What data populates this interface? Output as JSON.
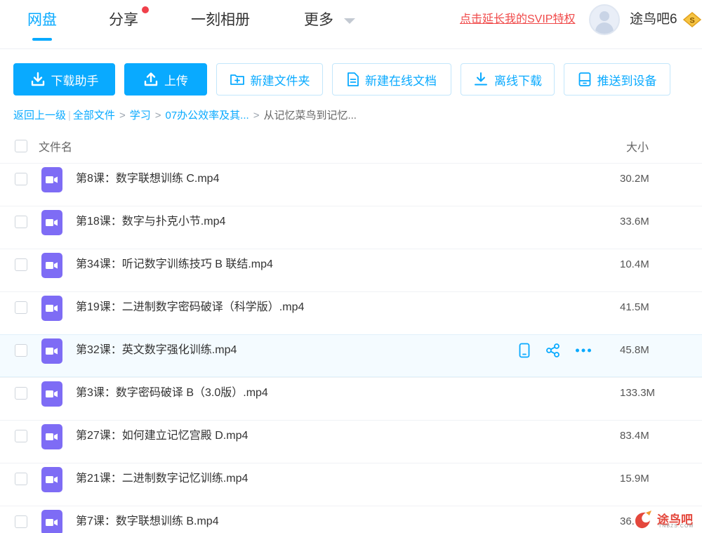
{
  "nav": {
    "items": [
      {
        "label": "网盘",
        "active": true
      },
      {
        "label": "分享",
        "active": false
      },
      {
        "label": "一刻相册",
        "active": false
      },
      {
        "label": "更多",
        "active": false
      }
    ],
    "svip_link": "点击延长我的SVIP特权",
    "username": "途鸟吧6",
    "vip_badge": "S"
  },
  "toolbar": {
    "download_helper": "下载助手",
    "upload": "上传",
    "new_folder": "新建文件夹",
    "new_online_doc": "新建在线文档",
    "offline_download": "离线下载",
    "push_to_device": "推送到设备"
  },
  "breadcrumb": {
    "back": "返回上一级",
    "all_files": "全部文件",
    "level1": "学习",
    "level2": "07办公效率及其...",
    "current": "从记忆菜鸟到记忆..."
  },
  "table": {
    "col_name": "文件名",
    "col_size": "大小",
    "rows": [
      {
        "name": "第8课：数字联想训练 C.mp4",
        "size": "30.2M"
      },
      {
        "name": "第18课：数字与扑克小节.mp4",
        "size": "33.6M"
      },
      {
        "name": "第34课：听记数字训练技巧 B 联结.mp4",
        "size": "10.4M"
      },
      {
        "name": "第19课：二进制数字密码破译（科学版）.mp4",
        "size": "41.5M"
      },
      {
        "name": "第32课：英文数字强化训练.mp4",
        "size": "45.8M"
      },
      {
        "name": "第3课：数字密码破译 B（3.0版）.mp4",
        "size": "133.3M"
      },
      {
        "name": "第27课：如何建立记忆宫殿 D.mp4",
        "size": "83.4M"
      },
      {
        "name": "第21课：二进制数字记忆训练.mp4",
        "size": "15.9M"
      },
      {
        "name": "第7课：数字联想训练 B.mp4",
        "size": "36."
      }
    ]
  },
  "watermark": {
    "text": "途鸟吧",
    "sub": "TNBZS.COM"
  },
  "colors": {
    "accent": "#09aaff",
    "video_icon": "#7e6cf5",
    "svip_red": "#f04a4a"
  }
}
